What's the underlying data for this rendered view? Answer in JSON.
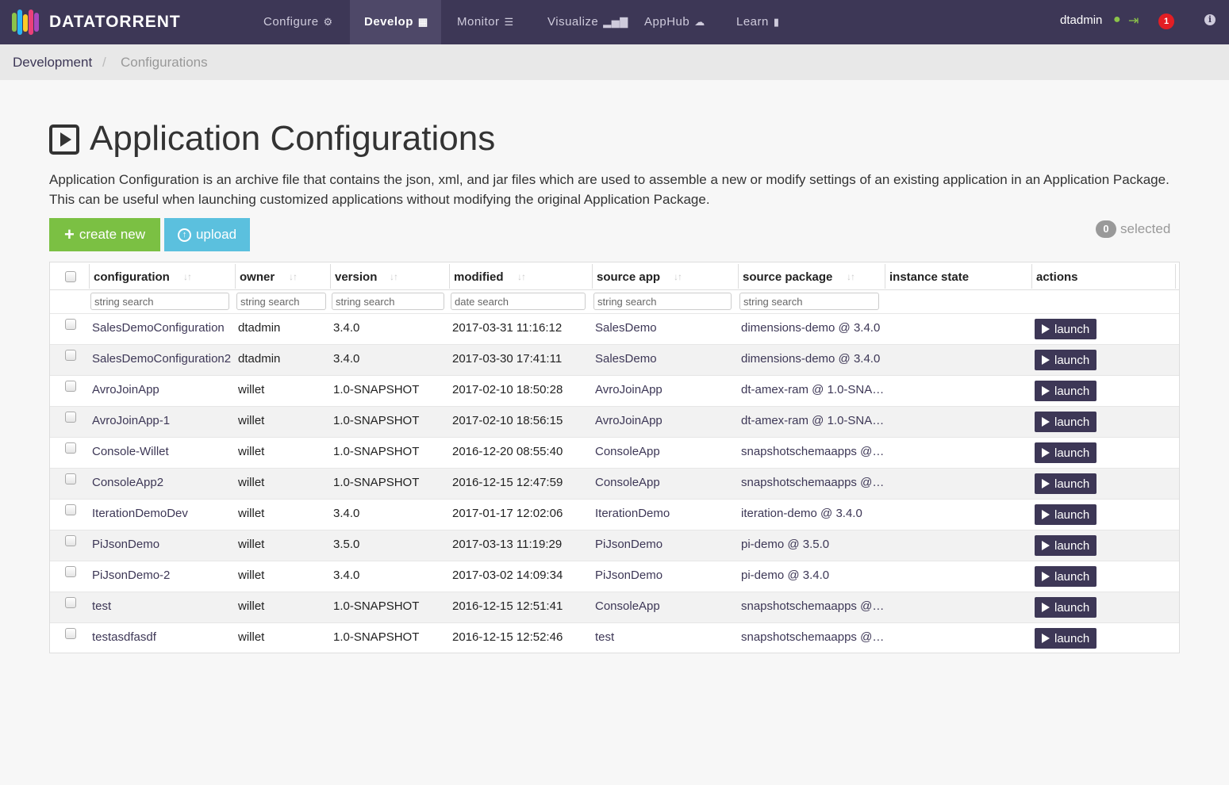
{
  "brand": {
    "name": "DATATORRENT"
  },
  "nav": {
    "items": [
      {
        "label": "Configure",
        "icon": "gear-icon"
      },
      {
        "label": "Develop",
        "icon": "grid-icon"
      },
      {
        "label": "Monitor",
        "icon": "server-icon"
      },
      {
        "label": "Visualize",
        "icon": "bar-chart-icon"
      },
      {
        "label": "AppHub",
        "icon": "cloud-icon"
      },
      {
        "label": "Learn",
        "icon": "book-icon"
      }
    ],
    "active": "Develop",
    "user": "dtadmin",
    "notifications": "1"
  },
  "breadcrumb": {
    "home": "Development",
    "separator": "/",
    "current": "Configurations"
  },
  "page": {
    "title": "Application Configurations",
    "description": "Application Configuration is an archive file that contains the json, xml, and jar files which are used to assemble a new or modify settings of an existing application in an Application Package. This can be useful when launching customized applications without modifying the original Application Package.",
    "create_label": "create new",
    "upload_label": "upload",
    "selected_count": "0",
    "selected_label": "selected"
  },
  "table": {
    "columns": [
      "configuration",
      "owner",
      "version",
      "modified",
      "source app",
      "source package",
      "instance state",
      "actions"
    ],
    "filters": [
      "string search",
      "string search",
      "string search",
      "date search",
      "string search",
      "string search"
    ],
    "launch_label": "launch",
    "rows": [
      {
        "configuration": "SalesDemoConfiguration",
        "owner": "dtadmin",
        "version": "3.4.0",
        "modified": "2017-03-31 11:16:12",
        "source_app": "SalesDemo",
        "source_package": "dimensions-demo @ 3.4.0"
      },
      {
        "configuration": "SalesDemoConfiguration2",
        "owner": "dtadmin",
        "version": "3.4.0",
        "modified": "2017-03-30 17:41:11",
        "source_app": "SalesDemo",
        "source_package": "dimensions-demo @ 3.4.0"
      },
      {
        "configuration": "AvroJoinApp",
        "owner": "willet",
        "version": "1.0-SNAPSHOT",
        "modified": "2017-02-10 18:50:28",
        "source_app": "AvroJoinApp",
        "source_package": "dt-amex-ram @ 1.0-SNA…"
      },
      {
        "configuration": "AvroJoinApp-1",
        "owner": "willet",
        "version": "1.0-SNAPSHOT",
        "modified": "2017-02-10 18:56:15",
        "source_app": "AvroJoinApp",
        "source_package": "dt-amex-ram @ 1.0-SNA…"
      },
      {
        "configuration": "Console-Willet",
        "owner": "willet",
        "version": "1.0-SNAPSHOT",
        "modified": "2016-12-20 08:55:40",
        "source_app": "ConsoleApp",
        "source_package": "snapshotschemaapps @…"
      },
      {
        "configuration": "ConsoleApp2",
        "owner": "willet",
        "version": "1.0-SNAPSHOT",
        "modified": "2016-12-15 12:47:59",
        "source_app": "ConsoleApp",
        "source_package": "snapshotschemaapps @…"
      },
      {
        "configuration": "IterationDemoDev",
        "owner": "willet",
        "version": "3.4.0",
        "modified": "2017-01-17 12:02:06",
        "source_app": "IterationDemo",
        "source_package": "iteration-demo @ 3.4.0"
      },
      {
        "configuration": "PiJsonDemo",
        "owner": "willet",
        "version": "3.5.0",
        "modified": "2017-03-13 11:19:29",
        "source_app": "PiJsonDemo",
        "source_package": "pi-demo @ 3.5.0"
      },
      {
        "configuration": "PiJsonDemo-2",
        "owner": "willet",
        "version": "3.4.0",
        "modified": "2017-03-02 14:09:34",
        "source_app": "PiJsonDemo",
        "source_package": "pi-demo @ 3.4.0"
      },
      {
        "configuration": "test",
        "owner": "willet",
        "version": "1.0-SNAPSHOT",
        "modified": "2016-12-15 12:51:41",
        "source_app": "ConsoleApp",
        "source_package": "snapshotschemaapps @…"
      },
      {
        "configuration": "testasdfasdf",
        "owner": "willet",
        "version": "1.0-SNAPSHOT",
        "modified": "2016-12-15 12:52:46",
        "source_app": "test",
        "source_package": "snapshotschemaapps @…"
      }
    ]
  },
  "colors": {
    "nav_bg": "#3d3756",
    "create": "#7bc043",
    "upload": "#5bc0de",
    "launch": "#3d3756",
    "notif": "#e31e24"
  }
}
